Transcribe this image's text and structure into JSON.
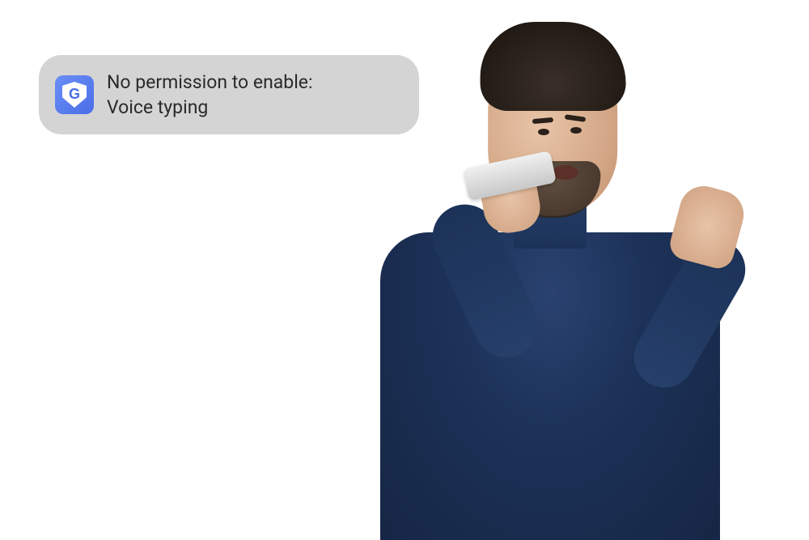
{
  "toast": {
    "line1": "No permission to enable:",
    "line2": "Voice typing",
    "app_icon_letter": "G"
  },
  "image_description": "Man in navy turtleneck holding smartphone near mouth, gesturing with left hand, looking confused"
}
